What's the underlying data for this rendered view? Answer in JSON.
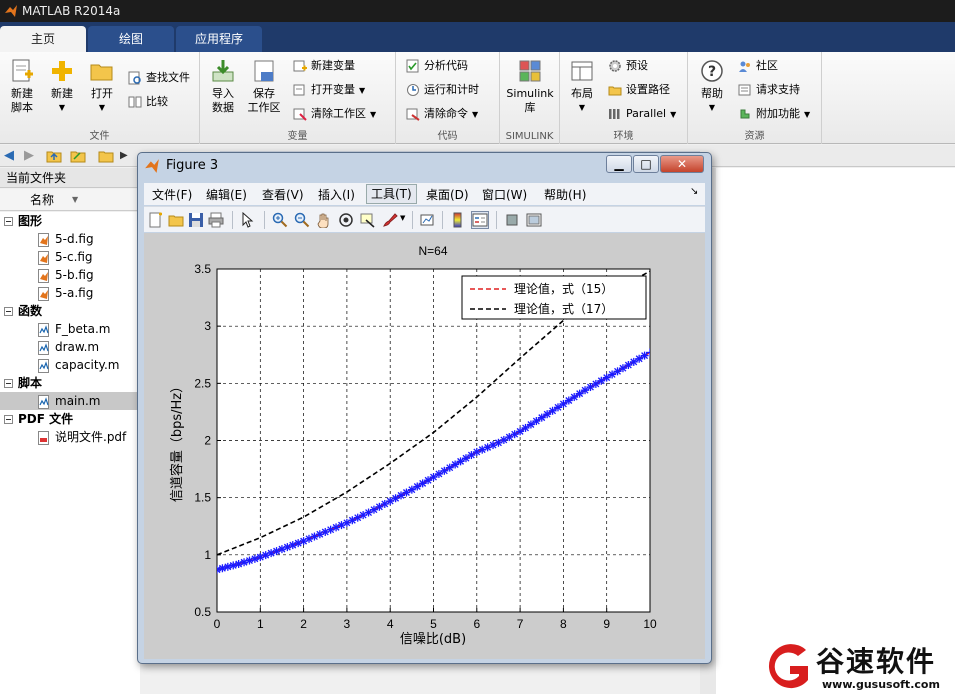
{
  "app": {
    "title": "MATLAB R2014a",
    "tabs": [
      "主页",
      "绘图",
      "应用程序"
    ]
  },
  "ribbon": {
    "file": {
      "label": "文件",
      "new_script": "新建\n脚本",
      "new": "新建",
      "open": "打开",
      "find_files": "查找文件",
      "compare": "比较"
    },
    "variable": {
      "label": "变量",
      "import": "导入\n数据",
      "save_ws": "保存\n工作区",
      "new_var": "新建变量",
      "open_var": "打开变量",
      "clear_ws": "清除工作区"
    },
    "code": {
      "label": "代码",
      "analyze": "分析代码",
      "run_time": "运行和计时",
      "clear_cmd": "清除命令"
    },
    "simulink": {
      "label": "SIMULINK",
      "lib": "Simulink\n库"
    },
    "env": {
      "label": "环境",
      "layout": "布局",
      "prefs": "预设",
      "set_path": "设置路径",
      "parallel": "Parallel"
    },
    "resources": {
      "label": "资源",
      "help": "帮助",
      "community": "社区",
      "support": "请求支持",
      "addons": "附加功能"
    }
  },
  "current_folder": {
    "title": "当前文件夹",
    "column": "名称",
    "tree": [
      {
        "type": "cat",
        "label": "图形"
      },
      {
        "type": "file",
        "label": "5-d.fig",
        "icon": "fig"
      },
      {
        "type": "file",
        "label": "5-c.fig",
        "icon": "fig"
      },
      {
        "type": "file",
        "label": "5-b.fig",
        "icon": "fig"
      },
      {
        "type": "file",
        "label": "5-a.fig",
        "icon": "fig"
      },
      {
        "type": "cat",
        "label": "函数"
      },
      {
        "type": "file",
        "label": "F_beta.m",
        "icon": "m"
      },
      {
        "type": "file",
        "label": "draw.m",
        "icon": "m"
      },
      {
        "type": "file",
        "label": "capacity.m",
        "icon": "m"
      },
      {
        "type": "cat",
        "label": "脚本"
      },
      {
        "type": "file",
        "label": "main.m",
        "icon": "m",
        "selected": true
      },
      {
        "type": "cat",
        "label": "PDF 文件"
      },
      {
        "type": "file",
        "label": "说明文件.pdf",
        "icon": "pdf"
      }
    ]
  },
  "figure": {
    "title": "Figure 3",
    "menus": [
      "文件(F)",
      "编辑(E)",
      "查看(V)",
      "插入(I)",
      "工具(T)",
      "桌面(D)",
      "窗口(W)",
      "帮助(H)"
    ]
  },
  "chart_data": {
    "type": "line",
    "title": "N=64",
    "xlabel": "信噪比(dB)",
    "ylabel": "信道容量（bps/Hz）",
    "xlim": [
      0,
      10
    ],
    "ylim": [
      0.5,
      3.5
    ],
    "xticks": [
      0,
      1,
      2,
      3,
      4,
      5,
      6,
      7,
      8,
      9,
      10
    ],
    "yticks": [
      0.5,
      1,
      1.5,
      2,
      2.5,
      3,
      3.5
    ],
    "grid": true,
    "legend_position": "top-right",
    "series": [
      {
        "name": "理论值，式（15）",
        "style": "dashed",
        "color": "#e02020",
        "x": [
          0,
          1,
          2,
          3,
          4,
          5,
          6,
          7,
          8,
          9,
          10
        ],
        "y": [
          0.87,
          0.98,
          1.12,
          1.28,
          1.47,
          1.68,
          1.9,
          2.08,
          2.32,
          2.55,
          2.77
        ]
      },
      {
        "name": "理论值，式（17）",
        "style": "dashed",
        "color": "#000000",
        "x": [
          0,
          1,
          2,
          3,
          4,
          5,
          6,
          7,
          8,
          9,
          10
        ],
        "y": [
          1.0,
          1.15,
          1.33,
          1.55,
          1.8,
          2.07,
          2.38,
          2.72,
          3.05,
          3.28,
          3.48
        ]
      },
      {
        "style": "marker",
        "color": "#1a1aff",
        "x": [
          0,
          0.5,
          1,
          1.5,
          2,
          2.5,
          3,
          3.5,
          4,
          4.5,
          5,
          5.5,
          6,
          6.5,
          7,
          7.5,
          8,
          8.5,
          9,
          9.5,
          10
        ],
        "y": [
          0.87,
          0.92,
          0.98,
          1.05,
          1.12,
          1.2,
          1.28,
          1.37,
          1.47,
          1.57,
          1.68,
          1.79,
          1.9,
          1.98,
          2.08,
          2.2,
          2.32,
          2.44,
          2.55,
          2.66,
          2.77
        ]
      }
    ]
  },
  "watermark": {
    "brand": "谷速软件",
    "url": "www.gususoft.com"
  }
}
